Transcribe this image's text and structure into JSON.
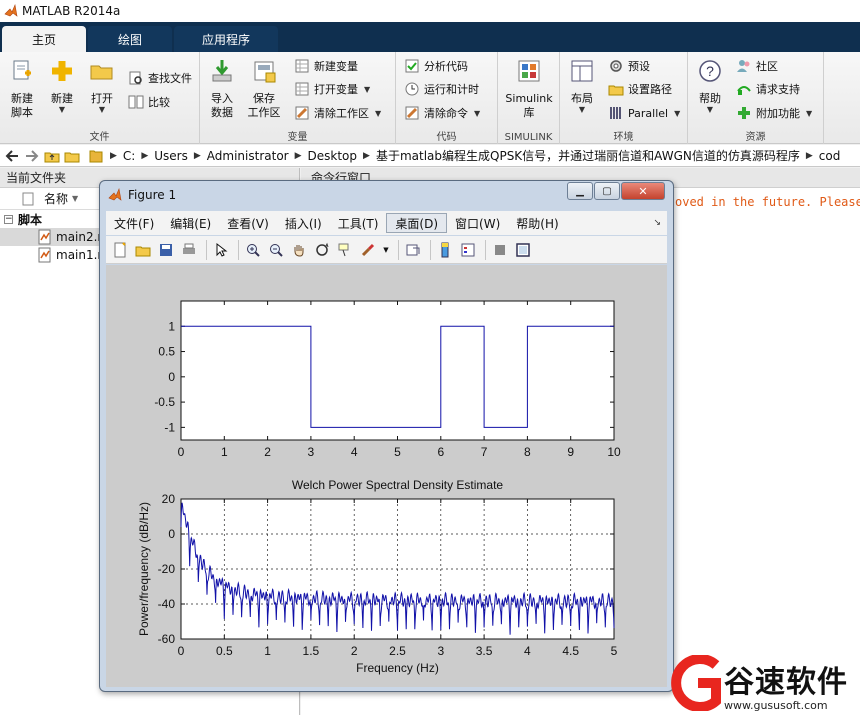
{
  "app": {
    "title": "MATLAB R2014a"
  },
  "tabs": [
    {
      "label": "主页"
    },
    {
      "label": "绘图"
    },
    {
      "label": "应用程序"
    }
  ],
  "ribbon": {
    "file": {
      "label": "文件",
      "new_script": "新建\n脚本",
      "new": "新建",
      "open": "打开",
      "find_files": "查找文件",
      "compare": "比较"
    },
    "variable": {
      "label": "变量",
      "import": "导入\n数据",
      "save_ws": "保存\n工作区",
      "new_var": "新建变量",
      "open_var": "打开变量",
      "clear_ws": "清除工作区"
    },
    "code": {
      "label": "代码",
      "analyze": "分析代码",
      "run_time": "运行和计时",
      "clear_cmd": "清除命令"
    },
    "simulink": {
      "label": "SIMULINK",
      "lib": "Simulink\n库"
    },
    "env": {
      "label": "环境",
      "layout": "布局",
      "prefs": "预设",
      "set_path": "设置路径",
      "parallel": "Parallel"
    },
    "resources": {
      "label": "资源",
      "help": "帮助",
      "community": "社区",
      "support": "请求支持",
      "addons": "附加功能"
    }
  },
  "address": {
    "segments": [
      "C:",
      "Users",
      "Administrator",
      "Desktop",
      "基于matlab编程生成QPSK信号，并通过瑞丽信道和AWGN信道的仿真源码程序",
      "cod"
    ]
  },
  "folder_panel": {
    "title": "当前文件夹",
    "col_name": "名称",
    "group": "脚本",
    "files": [
      {
        "name": "main2.m",
        "selected": true
      },
      {
        "name": "main1.m",
        "selected": false
      }
    ]
  },
  "command_window": {
    "title": "命令行窗口",
    "warning_fragment": "oved in the future. Please"
  },
  "figure": {
    "title": "Figure 1",
    "menus": [
      "文件(F)",
      "编辑(E)",
      "查看(V)",
      "插入(I)",
      "工具(T)",
      "桌面(D)",
      "窗口(W)",
      "帮助(H)"
    ],
    "highlighted_menu": "桌面(D)"
  },
  "chart_data": [
    {
      "type": "line",
      "title": "",
      "xlabel": "",
      "ylabel": "",
      "xlim": [
        0,
        10
      ],
      "ylim": [
        -1.25,
        1.5
      ],
      "xticks": [
        "0",
        "1",
        "2",
        "3",
        "4",
        "5",
        "6",
        "7",
        "8",
        "9",
        "10"
      ],
      "yticks": [
        "1",
        "0.5",
        "0",
        "-0.5",
        "-1"
      ],
      "grid": false,
      "color": "#1010a8",
      "x": [
        0,
        3,
        3,
        6,
        6,
        7,
        7,
        8,
        8,
        10
      ],
      "y": [
        1,
        1,
        -1,
        -1,
        1,
        1,
        -1,
        -1,
        1,
        1
      ]
    },
    {
      "type": "line",
      "title": "Welch Power Spectral Density Estimate",
      "xlabel": "Frequency (Hz)",
      "ylabel": "Power/frequency (dB/Hz)",
      "xlim": [
        0,
        5
      ],
      "ylim": [
        -60,
        20
      ],
      "xticks": [
        "0",
        "0.5",
        "1",
        "1.5",
        "2",
        "2.5",
        "3",
        "3.5",
        "4",
        "4.5",
        "5"
      ],
      "yticks": [
        "20",
        "0",
        "-20",
        "-40",
        "-60"
      ],
      "grid": true,
      "color": "#1010a8",
      "peak_db": 14,
      "notch_spacing_hz": 0.1,
      "floor_db": -38
    }
  ],
  "watermark": {
    "text": "谷速软件",
    "url": "www.gususoft.com"
  },
  "colors": {
    "tab_bar": "#0f2f4f",
    "plot_line": "#1010a8",
    "warning": "#e05a17"
  }
}
